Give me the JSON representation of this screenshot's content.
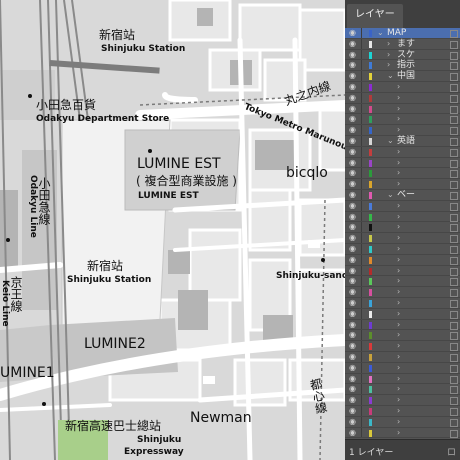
{
  "map": {
    "labels": {
      "shinjuku_station_jp": "新宿站",
      "shinjuku_station_en": "Shinjuku Station",
      "odakyu_dept_jp": "小田急百貨",
      "odakyu_dept_en": "Odakyu Department Store",
      "lumine_est_jp": "LUMINE EST",
      "lumine_est_sub": "( 複合型商業設施 )",
      "lumine_est_en": "LUMINE EST",
      "marunouchi_jp": "丸之内線",
      "marunouchi_en": "Tokyo Metro Marunouchi",
      "bicqlo": "bicqlo",
      "odakyu_line_jp": "小田急線",
      "odakyu_line_en": "Odakyu Line",
      "shinjuku_station2_jp": "新宿站",
      "shinjuku_station2_en": "Shinjuku Station",
      "shinjuku_san_en": "Shinjuku-sanc",
      "keio_jp": "京王線",
      "keio_en": "Keio Line",
      "lumine2": "LUMINE2",
      "lumine1": "UMINE1",
      "newman": "Newman",
      "expressway_jp": "新宿高速巴士總站",
      "expressway_en1": "Shinjuku",
      "expressway_en2": "Expressway",
      "oshinokami_jp": "都心線"
    }
  },
  "layers_panel": {
    "tab_label": "レイヤー",
    "footer_count": "1 レイヤー",
    "footer_right": "ロ",
    "rows": [
      {
        "label": "MAP",
        "indent": 0,
        "expanded": true,
        "selected": true,
        "color": "#3a63c8"
      },
      {
        "label": "ます",
        "indent": 1,
        "expanded": false,
        "color": "#e7e7e7"
      },
      {
        "label": "スケ",
        "indent": 1,
        "expanded": false,
        "color": "#1dd4d4"
      },
      {
        "label": "指示",
        "indent": 1,
        "expanded": false,
        "color": "#3f7bd6"
      },
      {
        "label": "中国",
        "indent": 1,
        "expanded": true,
        "color": "#e3d23a"
      },
      {
        "label": "",
        "indent": 2,
        "expanded": false,
        "color": "#8b2bd3"
      },
      {
        "label": "",
        "indent": 2,
        "expanded": false,
        "color": "#b03b3b"
      },
      {
        "label": "",
        "indent": 2,
        "expanded": false,
        "color": "#d14b8c"
      },
      {
        "label": "",
        "indent": 2,
        "expanded": false,
        "color": "#2f9e5d"
      },
      {
        "label": "",
        "indent": 2,
        "expanded": false,
        "color": "#3565c9"
      },
      {
        "label": "英語",
        "indent": 1,
        "expanded": true,
        "color": "#d7d7d7"
      },
      {
        "label": "",
        "indent": 2,
        "expanded": false,
        "color": "#c43e3e"
      },
      {
        "label": "",
        "indent": 2,
        "expanded": false,
        "color": "#9a44c7"
      },
      {
        "label": "",
        "indent": 2,
        "expanded": false,
        "color": "#2b9b3b"
      },
      {
        "label": "",
        "indent": 2,
        "expanded": false,
        "color": "#d9a52c"
      },
      {
        "label": "ベー",
        "indent": 1,
        "expanded": true,
        "color": "#e05ab0"
      },
      {
        "label": "",
        "indent": 2,
        "expanded": false,
        "color": "#4a7bd9"
      },
      {
        "label": "",
        "indent": 2,
        "expanded": false,
        "color": "#35b84a"
      },
      {
        "label": "",
        "indent": 2,
        "expanded": false,
        "color": "#111111"
      },
      {
        "label": "",
        "indent": 2,
        "expanded": false,
        "color": "#c7c74a"
      },
      {
        "label": "",
        "indent": 2,
        "expanded": false,
        "color": "#2fc8c8"
      },
      {
        "label": "",
        "indent": 2,
        "expanded": false,
        "color": "#e08a2c"
      },
      {
        "label": "",
        "indent": 2,
        "expanded": false,
        "color": "#b42b2b"
      },
      {
        "label": "",
        "indent": 2,
        "expanded": false,
        "color": "#5ac85a"
      },
      {
        "label": "",
        "indent": 2,
        "expanded": false,
        "color": "#d64f9e"
      },
      {
        "label": "",
        "indent": 2,
        "expanded": false,
        "color": "#3aa3d9"
      },
      {
        "label": "",
        "indent": 2,
        "expanded": false,
        "color": "#eaeaea"
      },
      {
        "label": "",
        "indent": 2,
        "expanded": false,
        "color": "#6e3bd3"
      },
      {
        "label": "",
        "indent": 2,
        "expanded": false,
        "color": "#5c8f2b"
      },
      {
        "label": "",
        "indent": 2,
        "expanded": false,
        "color": "#d93a3a"
      },
      {
        "label": "",
        "indent": 2,
        "expanded": false,
        "color": "#c9a23b"
      },
      {
        "label": "",
        "indent": 2,
        "expanded": false,
        "color": "#3b5bd9"
      },
      {
        "label": "",
        "indent": 2,
        "expanded": false,
        "color": "#e070c0"
      },
      {
        "label": "",
        "indent": 2,
        "expanded": false,
        "color": "#4cc0a0"
      },
      {
        "label": "",
        "indent": 2,
        "expanded": false,
        "color": "#8a3bd3"
      },
      {
        "label": "",
        "indent": 2,
        "expanded": false,
        "color": "#c83b7a"
      },
      {
        "label": "",
        "indent": 2,
        "expanded": false,
        "color": "#3bb8c8"
      },
      {
        "label": "",
        "indent": 2,
        "expanded": false,
        "color": "#d9c83b"
      }
    ]
  }
}
